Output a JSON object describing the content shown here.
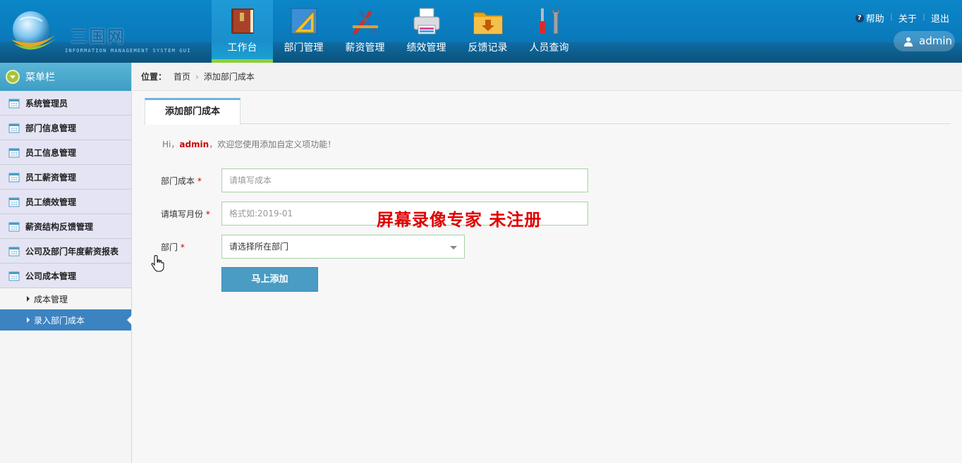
{
  "header": {
    "logo_title": "三国网",
    "logo_subtitle": "INFORMATION MANAGEMENT SYSTEM GUI",
    "nav": [
      {
        "label": "工作台",
        "icon": "book-icon",
        "active": true
      },
      {
        "label": "部门管理",
        "icon": "ruler-icon",
        "active": false
      },
      {
        "label": "薪资管理",
        "icon": "tools-icon",
        "active": false
      },
      {
        "label": "绩效管理",
        "icon": "printer-icon",
        "active": false
      },
      {
        "label": "反馈记录",
        "icon": "folder-download-icon",
        "active": false
      },
      {
        "label": "人员查询",
        "icon": "wrench-screwdriver-icon",
        "active": false
      }
    ],
    "links": {
      "help": "帮助",
      "about": "关于",
      "logout": "退出"
    },
    "user": "admin"
  },
  "sidebar": {
    "title": "菜单栏",
    "items": [
      {
        "label": "系统管理员"
      },
      {
        "label": "部门信息管理"
      },
      {
        "label": "员工信息管理"
      },
      {
        "label": "员工薪资管理"
      },
      {
        "label": "员工绩效管理"
      },
      {
        "label": "薪资结构反馈管理"
      },
      {
        "label": "公司及部门年度薪资报表"
      },
      {
        "label": "公司成本管理"
      }
    ],
    "sub_items": [
      {
        "label": "成本管理",
        "active": false
      },
      {
        "label": "录入部门成本",
        "active": true
      }
    ]
  },
  "breadcrumb": {
    "location_label": "位置：",
    "home": "首页",
    "current": "添加部门成本"
  },
  "tab": {
    "label": "添加部门成本"
  },
  "welcome": {
    "prefix": "Hi，",
    "user": "admin",
    "suffix": "，欢迎您使用添加自定义项功能！"
  },
  "form": {
    "cost": {
      "label": "部门成本",
      "required": "*",
      "placeholder": "请填写成本"
    },
    "month": {
      "label": "请填写月份",
      "required": "*",
      "placeholder": "格式如:2019-01"
    },
    "department": {
      "label": "部门",
      "required": "*",
      "selected": "请选择所在部门"
    },
    "submit": "马上添加"
  },
  "watermark": "屏幕录像专家  未注册",
  "colors": {
    "header": "#0b7fc0",
    "active_nav_underline": "#8ccf3a",
    "submit": "#4a9cc4",
    "required": "#cc0000"
  }
}
